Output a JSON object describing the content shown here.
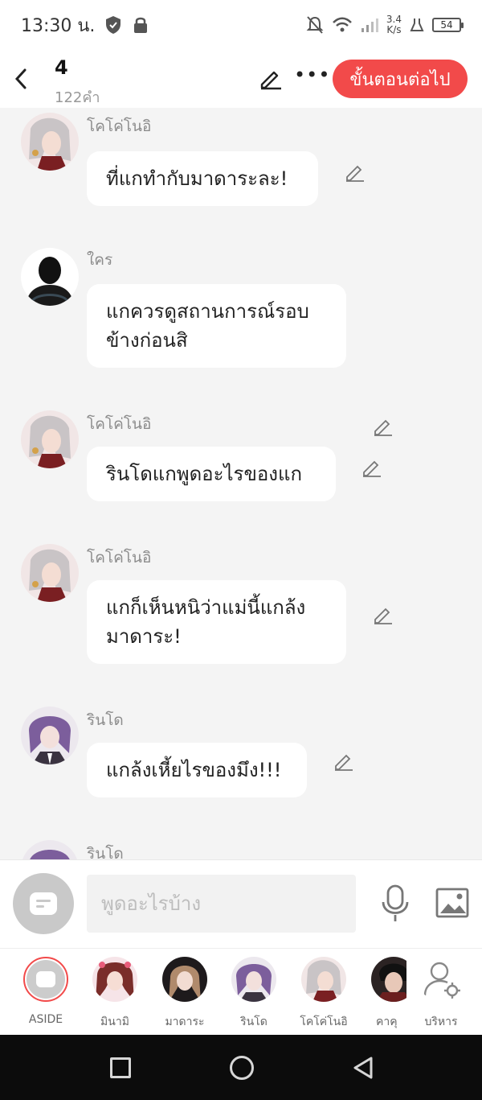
{
  "status_bar": {
    "time": "13:30 น.",
    "net_speed_value": "3.4",
    "net_speed_unit": "K/s",
    "battery": "54"
  },
  "header": {
    "title": "4",
    "word_count": "122คำ",
    "next_label": "ขั้นตอนต่อไป"
  },
  "messages": [
    {
      "sender": "โคโค่โนอิ",
      "text": "ที่แกทำกับมาดาระละ!"
    },
    {
      "sender": "ใคร",
      "text": "แกควรดูสถานการณ์รอบข้างก่อนสิ"
    },
    {
      "sender": "โคโค่โนอิ",
      "text": "รินโดแกพูดอะไรของแก"
    },
    {
      "sender": "โคโค่โนอิ",
      "text": "แกก็เห็นหนิว่าแม่นี้แกล้งมาดาระ!"
    },
    {
      "sender": "รินโด",
      "text": "แกล้งเหี้ยไรของมึง!!!"
    },
    {
      "sender": "รินโด",
      "text": ""
    }
  ],
  "input": {
    "placeholder": "พูดอะไรบ้าง"
  },
  "characters": [
    {
      "name": "ASIDE"
    },
    {
      "name": "มินามิ"
    },
    {
      "name": "มาดาระ"
    },
    {
      "name": "รินโด"
    },
    {
      "name": "โคโค่โนอิ"
    },
    {
      "name": "คาคุ"
    },
    {
      "name": "บริหาร"
    }
  ],
  "colors": {
    "accent": "#f24a4a",
    "background": "#f4f4f4",
    "bubble": "#ffffff"
  }
}
